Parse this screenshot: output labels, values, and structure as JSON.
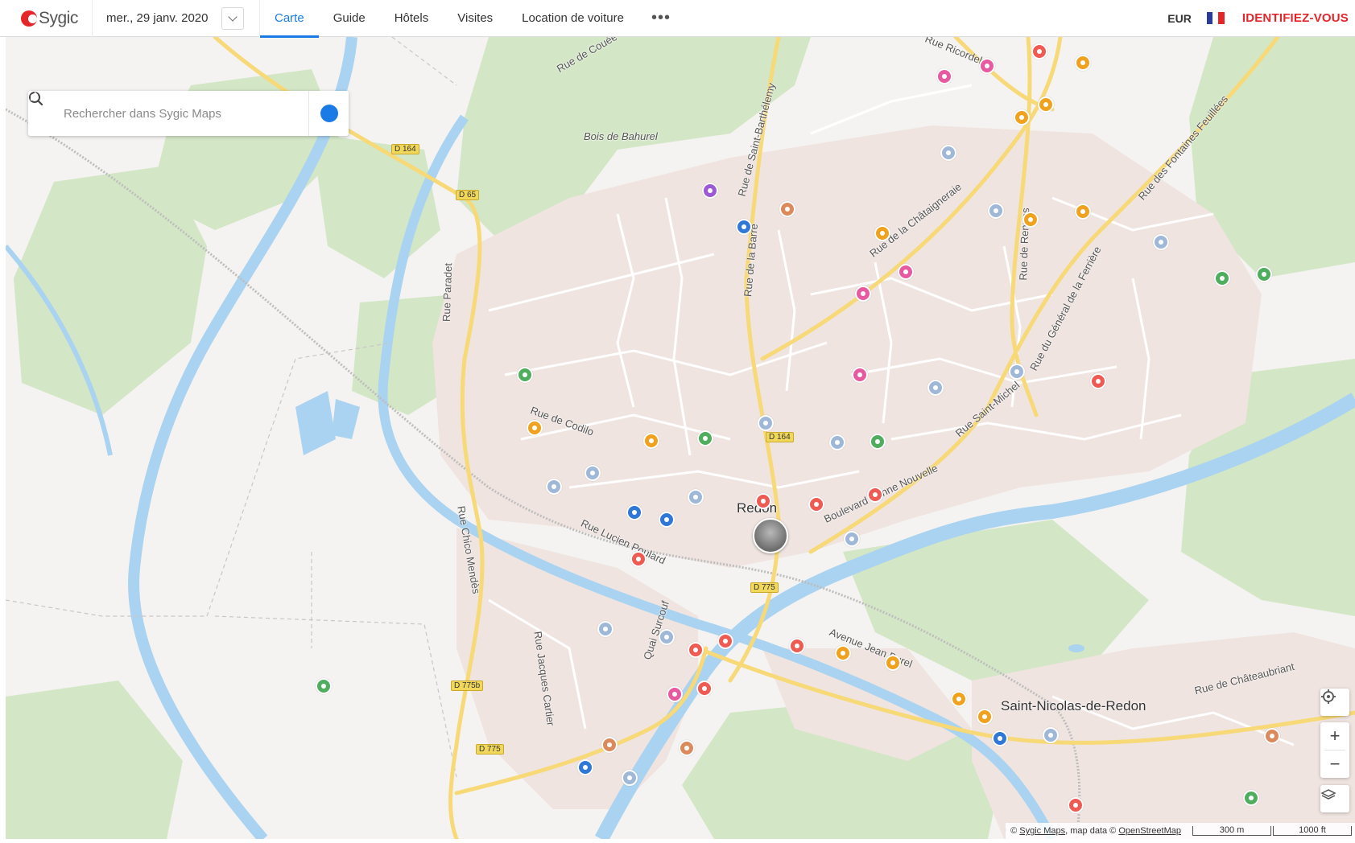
{
  "header": {
    "logo_text": "Sygic",
    "date": "mer., 29 janv. 2020",
    "nav": [
      {
        "label": "Carte",
        "active": true
      },
      {
        "label": "Guide",
        "active": false
      },
      {
        "label": "Hôtels",
        "active": false
      },
      {
        "label": "Visites",
        "active": false
      },
      {
        "label": "Location de voiture",
        "active": false
      }
    ],
    "more_label": "•••",
    "currency": "EUR",
    "language_flag": "france-flag-icon",
    "login_label": "IDENTIFIEZ-VOUS"
  },
  "search": {
    "placeholder": "Rechercher dans Sygic Maps"
  },
  "map": {
    "labels": {
      "redon": "Redon",
      "saint_nicolas": "Saint-Nicolas-de-Redon",
      "bois": "Bois de Bahurel",
      "rue_couee": "Rue de Couée",
      "rue_ricordel": "Rue Ricordel",
      "rue_barthelemy": "Rue de Saint-Barthélemy",
      "rue_barre": "Rue de la Barre",
      "rue_chataigneraie": "Rue de la Châtaigneraie",
      "rue_rennes": "Rue de Rennes",
      "rue_ferriere": "Rue du Général de la Ferrière",
      "rue_fontaines": "Rue des Fontaines Feuillées",
      "rue_paradet": "Rue Paradet",
      "rue_codilo": "Rue de Codilo",
      "rue_saint_michel": "Rue Saint-Michel",
      "bd_bonne_nouvelle": "Boulevard Bonne Nouvelle",
      "rue_lucien_poulard": "Rue Lucien Poulard",
      "rue_chico_mendes": "Rue Chico Mendès",
      "rue_jacques_cartier": "Rue Jacques Cartier",
      "quai_surcouf": "Quai Surcouf",
      "av_jean_burel": "Avenue Jean Burel",
      "rue_chateaubriant": "Rue de Châteaubriant"
    },
    "roads": {
      "d164_a": "D 164",
      "d65": "D 65",
      "d164_b": "D 164",
      "d775_a": "D 775",
      "d775b": "D 775b",
      "d775_c": "D 775"
    },
    "colors": {
      "water": "#a9d3f0",
      "forest": "#cfe3c2",
      "urban": "#ede3df",
      "road": "#ffffff",
      "main_road": "#f7d978",
      "poi_orange": "#f0a11d",
      "poi_pink": "#e85aa0",
      "poi_red": "#ef5b52",
      "poi_green": "#4fae5d",
      "poi_blue": "#2f78d8",
      "poi_lightblue": "#9fb8d8",
      "poi_purple": "#9b59d6",
      "poi_brown": "#dc8a5c"
    },
    "pois": [
      {
        "name": "bar-icon",
        "color": "#e85aa0"
      },
      {
        "name": "music-icon",
        "color": "#e85aa0"
      },
      {
        "name": "restaurant-icon",
        "color": "#ef5b52"
      },
      {
        "name": "ticket-icon",
        "color": "#f0a11d"
      },
      {
        "name": "car-icon",
        "color": "#f0a11d"
      },
      {
        "name": "boat-icon",
        "color": "#f0a11d"
      },
      {
        "name": "school-icon",
        "color": "#9fb8d8"
      },
      {
        "name": "fuel-icon",
        "color": "#2f78d8"
      },
      {
        "name": "bench-icon",
        "color": "#dc8a5c"
      },
      {
        "name": "balloon-icon",
        "color": "#9b59d6"
      },
      {
        "name": "headphones-icon",
        "color": "#f0a11d"
      },
      {
        "name": "theatre-icon",
        "color": "#e85aa0"
      },
      {
        "name": "cocktail-icon",
        "color": "#e85aa0"
      },
      {
        "name": "hospital-icon",
        "color": "#9fb8d8"
      },
      {
        "name": "key-icon",
        "color": "#f0a11d"
      },
      {
        "name": "settings-icon",
        "color": "#f0a11d"
      },
      {
        "name": "church-icon",
        "color": "#9fb8d8"
      },
      {
        "name": "hiking-icon",
        "color": "#4fae5d"
      },
      {
        "name": "hiking-icon",
        "color": "#4fae5d"
      },
      {
        "name": "target-icon",
        "color": "#4fae5d"
      },
      {
        "name": "theatre-icon",
        "color": "#e85aa0"
      },
      {
        "name": "office-icon",
        "color": "#9fb8d8"
      },
      {
        "name": "hotel-icon",
        "color": "#9fb8d8"
      },
      {
        "name": "fire-station-icon",
        "color": "#ef5b52"
      },
      {
        "name": "hammer-icon",
        "color": "#f0a11d"
      },
      {
        "name": "shopping-cart-icon",
        "color": "#f0a11d"
      },
      {
        "name": "target-icon",
        "color": "#4fae5d"
      },
      {
        "name": "office-icon",
        "color": "#9fb8d8"
      },
      {
        "name": "medical-icon",
        "color": "#9fb8d8"
      },
      {
        "name": "target-icon",
        "color": "#4fae5d"
      },
      {
        "name": "monument-icon",
        "color": "#9fb8d8"
      },
      {
        "name": "office-icon",
        "color": "#9fb8d8"
      },
      {
        "name": "info-icon",
        "color": "#2f78d8"
      },
      {
        "name": "train-icon",
        "color": "#2f78d8"
      },
      {
        "name": "monument-icon",
        "color": "#9fb8d8"
      },
      {
        "name": "restaurant-icon",
        "color": "#ef5b52"
      },
      {
        "name": "restaurant-icon",
        "color": "#ef5b52"
      },
      {
        "name": "camera-icon",
        "color": "#ef5b52"
      },
      {
        "name": "office-icon",
        "color": "#9fb8d8"
      },
      {
        "name": "library-icon",
        "color": "#ef5b52"
      },
      {
        "name": "monument-icon",
        "color": "#9fb8d8"
      },
      {
        "name": "scooter-icon",
        "color": "#9fb8d8"
      },
      {
        "name": "restaurant-icon",
        "color": "#ef5b52"
      },
      {
        "name": "camera-icon",
        "color": "#ef5b52"
      },
      {
        "name": "restaurant-icon",
        "color": "#ef5b52"
      },
      {
        "name": "car-icon",
        "color": "#f0a11d"
      },
      {
        "name": "bag-icon",
        "color": "#f0a11d"
      },
      {
        "name": "cinema-icon",
        "color": "#e85aa0"
      },
      {
        "name": "camera-icon",
        "color": "#ef5b52"
      },
      {
        "name": "key-icon",
        "color": "#f0a11d"
      },
      {
        "name": "hammer-icon",
        "color": "#f0a11d"
      },
      {
        "name": "wrench-icon",
        "color": "#2f78d8"
      },
      {
        "name": "palette-icon",
        "color": "#9fb8d8"
      },
      {
        "name": "horse-icon",
        "color": "#4fae5d"
      },
      {
        "name": "cafe-icon",
        "color": "#dc8a5c"
      },
      {
        "name": "bench-icon",
        "color": "#dc8a5c"
      },
      {
        "name": "fuel-icon",
        "color": "#2f78d8"
      },
      {
        "name": "pin-icon",
        "color": "#9fb8d8"
      },
      {
        "name": "bench-icon",
        "color": "#dc8a5c"
      },
      {
        "name": "soccer-icon",
        "color": "#4fae5d"
      },
      {
        "name": "school-icon",
        "color": "#ef5b52"
      }
    ]
  },
  "controls": {
    "locate": "locate-icon",
    "zoom_in": "+",
    "zoom_out": "−",
    "layers": "layers-icon"
  },
  "attribution": {
    "prefix": "©",
    "sygic": "Sygic Maps",
    "mid": ", map data ©",
    "osm": "OpenStreetMap",
    "scale_m": "300 m",
    "scale_ft": "1000 ft"
  }
}
